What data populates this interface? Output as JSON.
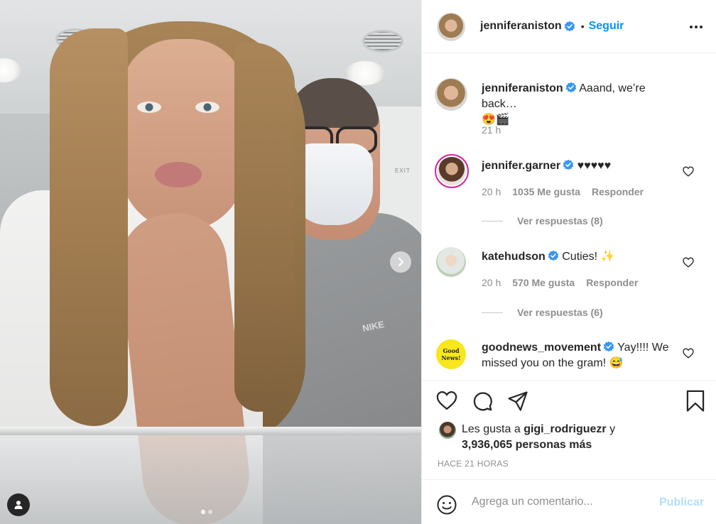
{
  "post": {
    "image_alt": "Selfie photo",
    "carousel": {
      "count": 2,
      "active_index": 0
    }
  },
  "header": {
    "username": "jenniferaniston",
    "separator": "•",
    "follow_label": "Seguir"
  },
  "caption": {
    "username": "jenniferaniston",
    "text": "Aaand, we’re back…",
    "emojis": "😍🎬",
    "time": "21 h"
  },
  "comments": [
    {
      "username": "jennifer.garner",
      "text": "♥♥♥♥♥",
      "time": "20 h",
      "likes": "1035 Me gusta",
      "reply": "Responder",
      "view_replies": "Ver respuestas (8)"
    },
    {
      "username": "katehudson",
      "text": "Cuties! ✨",
      "time": "20 h",
      "likes": "570 Me gusta",
      "reply": "Responder",
      "view_replies": "Ver respuestas (6)"
    },
    {
      "username": "goodnews_movement",
      "text": "Yay!!!! We missed you on the gram! 😅",
      "avatar_text": "Good News!"
    }
  ],
  "likes": {
    "prefix": "Les gusta a",
    "user": "gigi_rodriguezr",
    "connector": "y",
    "count": "3,936,065 personas más"
  },
  "time_ago": "HACE 21 HORAS",
  "comment_input": {
    "placeholder": "Agrega un comentario...",
    "publish_label": "Publicar"
  },
  "icons": {
    "verified": "verified-badge-icon",
    "heart": "heart-icon",
    "comment": "comment-icon",
    "share": "share-icon",
    "save": "bookmark-icon",
    "more": "more-icon",
    "emoji": "emoji-icon",
    "next": "chevron-right-icon",
    "user_tag": "user-tag-icon"
  },
  "colors": {
    "accent": "#0095f6",
    "verified": "#3897f0",
    "muted": "#8e8e8e",
    "publish_disabled": "#b2dffc"
  }
}
